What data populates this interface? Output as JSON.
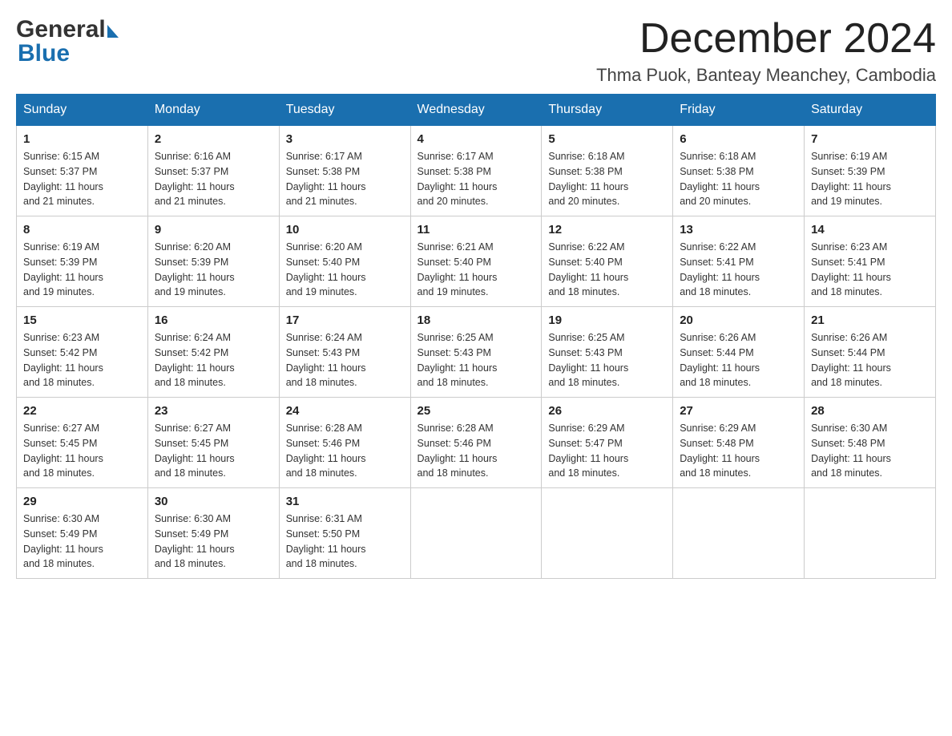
{
  "header": {
    "logo_general": "General",
    "logo_blue": "Blue",
    "month_title": "December 2024",
    "location": "Thma Puok, Banteay Meanchey, Cambodia"
  },
  "days_of_week": [
    "Sunday",
    "Monday",
    "Tuesday",
    "Wednesday",
    "Thursday",
    "Friday",
    "Saturday"
  ],
  "weeks": [
    [
      {
        "day": "1",
        "sunrise": "6:15 AM",
        "sunset": "5:37 PM",
        "daylight": "11 hours and 21 minutes."
      },
      {
        "day": "2",
        "sunrise": "6:16 AM",
        "sunset": "5:37 PM",
        "daylight": "11 hours and 21 minutes."
      },
      {
        "day": "3",
        "sunrise": "6:17 AM",
        "sunset": "5:38 PM",
        "daylight": "11 hours and 21 minutes."
      },
      {
        "day": "4",
        "sunrise": "6:17 AM",
        "sunset": "5:38 PM",
        "daylight": "11 hours and 20 minutes."
      },
      {
        "day": "5",
        "sunrise": "6:18 AM",
        "sunset": "5:38 PM",
        "daylight": "11 hours and 20 minutes."
      },
      {
        "day": "6",
        "sunrise": "6:18 AM",
        "sunset": "5:38 PM",
        "daylight": "11 hours and 20 minutes."
      },
      {
        "day": "7",
        "sunrise": "6:19 AM",
        "sunset": "5:39 PM",
        "daylight": "11 hours and 19 minutes."
      }
    ],
    [
      {
        "day": "8",
        "sunrise": "6:19 AM",
        "sunset": "5:39 PM",
        "daylight": "11 hours and 19 minutes."
      },
      {
        "day": "9",
        "sunrise": "6:20 AM",
        "sunset": "5:39 PM",
        "daylight": "11 hours and 19 minutes."
      },
      {
        "day": "10",
        "sunrise": "6:20 AM",
        "sunset": "5:40 PM",
        "daylight": "11 hours and 19 minutes."
      },
      {
        "day": "11",
        "sunrise": "6:21 AM",
        "sunset": "5:40 PM",
        "daylight": "11 hours and 19 minutes."
      },
      {
        "day": "12",
        "sunrise": "6:22 AM",
        "sunset": "5:40 PM",
        "daylight": "11 hours and 18 minutes."
      },
      {
        "day": "13",
        "sunrise": "6:22 AM",
        "sunset": "5:41 PM",
        "daylight": "11 hours and 18 minutes."
      },
      {
        "day": "14",
        "sunrise": "6:23 AM",
        "sunset": "5:41 PM",
        "daylight": "11 hours and 18 minutes."
      }
    ],
    [
      {
        "day": "15",
        "sunrise": "6:23 AM",
        "sunset": "5:42 PM",
        "daylight": "11 hours and 18 minutes."
      },
      {
        "day": "16",
        "sunrise": "6:24 AM",
        "sunset": "5:42 PM",
        "daylight": "11 hours and 18 minutes."
      },
      {
        "day": "17",
        "sunrise": "6:24 AM",
        "sunset": "5:43 PM",
        "daylight": "11 hours and 18 minutes."
      },
      {
        "day": "18",
        "sunrise": "6:25 AM",
        "sunset": "5:43 PM",
        "daylight": "11 hours and 18 minutes."
      },
      {
        "day": "19",
        "sunrise": "6:25 AM",
        "sunset": "5:43 PM",
        "daylight": "11 hours and 18 minutes."
      },
      {
        "day": "20",
        "sunrise": "6:26 AM",
        "sunset": "5:44 PM",
        "daylight": "11 hours and 18 minutes."
      },
      {
        "day": "21",
        "sunrise": "6:26 AM",
        "sunset": "5:44 PM",
        "daylight": "11 hours and 18 minutes."
      }
    ],
    [
      {
        "day": "22",
        "sunrise": "6:27 AM",
        "sunset": "5:45 PM",
        "daylight": "11 hours and 18 minutes."
      },
      {
        "day": "23",
        "sunrise": "6:27 AM",
        "sunset": "5:45 PM",
        "daylight": "11 hours and 18 minutes."
      },
      {
        "day": "24",
        "sunrise": "6:28 AM",
        "sunset": "5:46 PM",
        "daylight": "11 hours and 18 minutes."
      },
      {
        "day": "25",
        "sunrise": "6:28 AM",
        "sunset": "5:46 PM",
        "daylight": "11 hours and 18 minutes."
      },
      {
        "day": "26",
        "sunrise": "6:29 AM",
        "sunset": "5:47 PM",
        "daylight": "11 hours and 18 minutes."
      },
      {
        "day": "27",
        "sunrise": "6:29 AM",
        "sunset": "5:48 PM",
        "daylight": "11 hours and 18 minutes."
      },
      {
        "day": "28",
        "sunrise": "6:30 AM",
        "sunset": "5:48 PM",
        "daylight": "11 hours and 18 minutes."
      }
    ],
    [
      {
        "day": "29",
        "sunrise": "6:30 AM",
        "sunset": "5:49 PM",
        "daylight": "11 hours and 18 minutes."
      },
      {
        "day": "30",
        "sunrise": "6:30 AM",
        "sunset": "5:49 PM",
        "daylight": "11 hours and 18 minutes."
      },
      {
        "day": "31",
        "sunrise": "6:31 AM",
        "sunset": "5:50 PM",
        "daylight": "11 hours and 18 minutes."
      },
      null,
      null,
      null,
      null
    ]
  ],
  "labels": {
    "sunrise": "Sunrise:",
    "sunset": "Sunset:",
    "daylight": "Daylight:"
  },
  "colors": {
    "header_bg": "#1a6faf",
    "border": "#cccccc",
    "logo_dark": "#333333",
    "logo_blue": "#1a6faf"
  }
}
